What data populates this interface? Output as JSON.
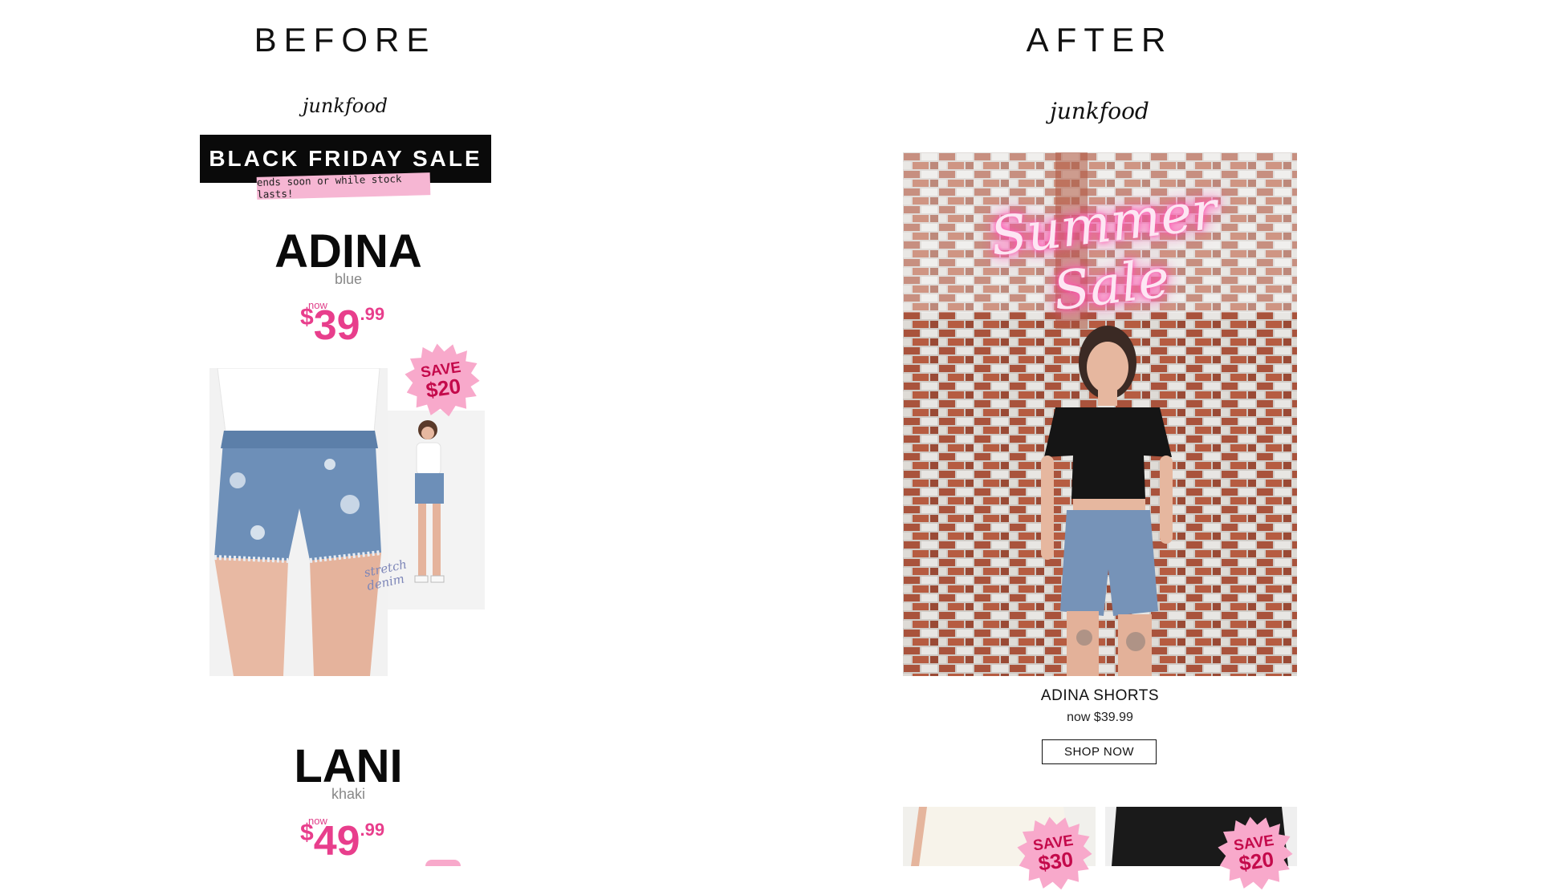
{
  "before": {
    "heading": "BEFORE",
    "logo": "junkfood",
    "banner": "BLACK FRIDAY SALE",
    "banner_tag": "ends soon or while stock lasts!",
    "products": [
      {
        "name": "ADINA",
        "color": "blue",
        "price_label": "now",
        "currency": "$",
        "price_whole": "39",
        "price_sep": ".",
        "price_cents": "99",
        "badge_top": "SAVE",
        "badge_bottom": "$20",
        "annotation": "stretch denim"
      },
      {
        "name": "LANI",
        "color": "khaki",
        "price_label": "now",
        "currency": "$",
        "price_whole": "49",
        "price_sep": ".",
        "price_cents": "99"
      }
    ]
  },
  "after": {
    "heading": "AFTER",
    "logo": "junkfood",
    "hero_neon": "Summer Sale",
    "product_name": "ADINA SHORTS",
    "product_price": "now $39.99",
    "cta": "SHOP NOW",
    "bottom_badges": [
      {
        "top": "SAVE",
        "bottom": "$30"
      },
      {
        "top": "SAVE",
        "bottom": "$20"
      }
    ]
  },
  "colors": {
    "accent_pink": "#e83e8c",
    "badge_pink": "#f8a9cb",
    "badge_text": "#c40a4b",
    "neon_glow": "#ff5eb5"
  }
}
